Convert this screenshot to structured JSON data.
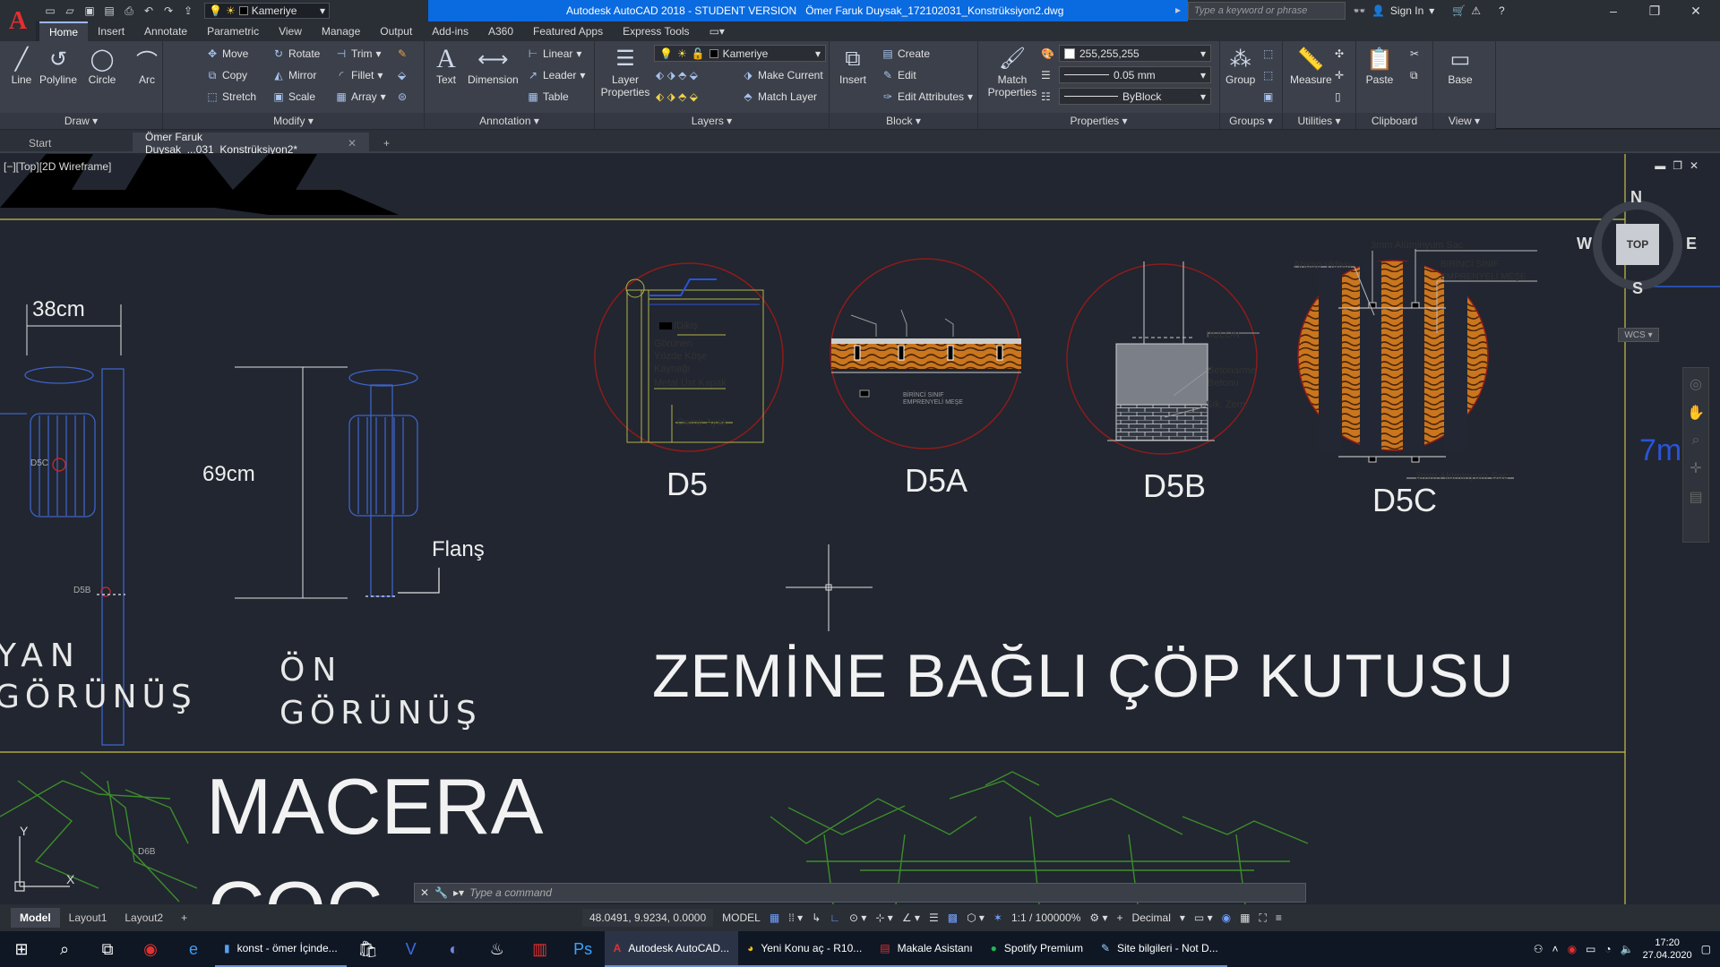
{
  "titlebar": {
    "workspace": "Kameriye",
    "app_title": "Autodesk AutoCAD 2018 - STUDENT VERSION",
    "file_title": "Ömer Faruk Duysak_172102031_Konstrüksiyon2.dwg",
    "search_placeholder": "Type a keyword or phrase",
    "signin": "Sign In"
  },
  "menu": [
    "Home",
    "Insert",
    "Annotate",
    "Parametric",
    "View",
    "Manage",
    "Output",
    "Add-ins",
    "A360",
    "Featured Apps",
    "Express Tools"
  ],
  "ribbon": {
    "draw": {
      "label": "Draw",
      "line": "Line",
      "polyline": "Polyline",
      "circle": "Circle",
      "arc": "Arc"
    },
    "modify": {
      "label": "Modify",
      "move": "Move",
      "rotate": "Rotate",
      "trim": "Trim",
      "copy": "Copy",
      "mirror": "Mirror",
      "fillet": "Fillet",
      "stretch": "Stretch",
      "scale": "Scale",
      "array": "Array"
    },
    "annotation": {
      "label": "Annotation",
      "text": "Text",
      "dimension": "Dimension",
      "linear": "Linear",
      "leader": "Leader",
      "table": "Table"
    },
    "layers": {
      "label": "Layers",
      "layer_properties": "Layer Properties",
      "current_layer": "Kameriye",
      "make_current": "Make Current",
      "match_layer": "Match Layer"
    },
    "block": {
      "label": "Block",
      "insert": "Insert",
      "create": "Create",
      "edit": "Edit",
      "edit_attributes": "Edit Attributes"
    },
    "properties": {
      "label": "Properties",
      "match_properties": "Match Properties",
      "color": "255,255,255",
      "lineweight": "0.05 mm",
      "linetype": "ByBlock"
    },
    "groups": {
      "label": "Groups",
      "group": "Group"
    },
    "utilities": {
      "label": "Utilities",
      "measure": "Measure"
    },
    "clipboard": {
      "label": "Clipboard",
      "paste": "Paste"
    },
    "view": {
      "label": "View",
      "base": "Base"
    }
  },
  "filetabs": {
    "start": "Start",
    "active": "Ömer Faruk Duysak_...031_Konstrüksiyon2*"
  },
  "viewport": {
    "label": "[−][Top][2D Wireframe]",
    "viewcube": {
      "n": "N",
      "s": "S",
      "e": "E",
      "w": "W",
      "top": "TOP",
      "wcs": "WCS"
    },
    "drawing": {
      "dim_38": "38cm",
      "dim_69": "69cm",
      "flans": "Flanş",
      "yan1": "YAN",
      "yan2": "GÖRÜNÜŞ",
      "on1": "ÖN",
      "on2": "GÖRÜNÜŞ",
      "title_main": "ZEMİNE BAĞLI ÇÖP KUTUSU",
      "macera": "MACERA",
      "d5": "D5",
      "d5a": "D5A",
      "d5b": "D5B",
      "d5c": "D5C",
      "d5c_small": "D5C",
      "d5b_small": "D5B",
      "d6b_small": "D6B",
      "d5_labels": [
        "IDikiş",
        "Görünen",
        "Yüzde Köşe",
        "Kaynağı",
        "Metal Üst Kapak",
        "Demir Ayak"
      ],
      "d5b_labels": [
        "BULON",
        "Betonarme",
        "Betonu",
        "Sık. Zem."
      ],
      "d5c_labels": [
        "3mm Alüminyum Sac",
        "Ahşap Vidası",
        "BİRİNCİ SINIF",
        "EMPRENYELİ MEŞE",
        "3mm Alüminyum Sac"
      ],
      "d5a_labels": [
        "BİRİNCİ SINIF",
        "EMPRENYELİ MEŞE"
      ],
      "ucs_y": "Y",
      "ucs_x": "X",
      "scale_text": "7m"
    }
  },
  "command": {
    "placeholder": "Type a command"
  },
  "layouts": [
    "Model",
    "Layout1",
    "Layout2"
  ],
  "status": {
    "coords": "48.0491, 9.9234, 0.0000",
    "model": "MODEL",
    "scale": "1:1 / 100000%",
    "units": "Decimal"
  },
  "taskbar": {
    "apps": [
      "konst - ömer İçinde...",
      "Autodesk AutoCAD...",
      "Yeni Konu aç - R10...",
      "Makale Asistanı",
      "Spotify Premium",
      "Site bilgileri - Not D..."
    ],
    "time": "17:20",
    "date": "27.04.2020"
  }
}
